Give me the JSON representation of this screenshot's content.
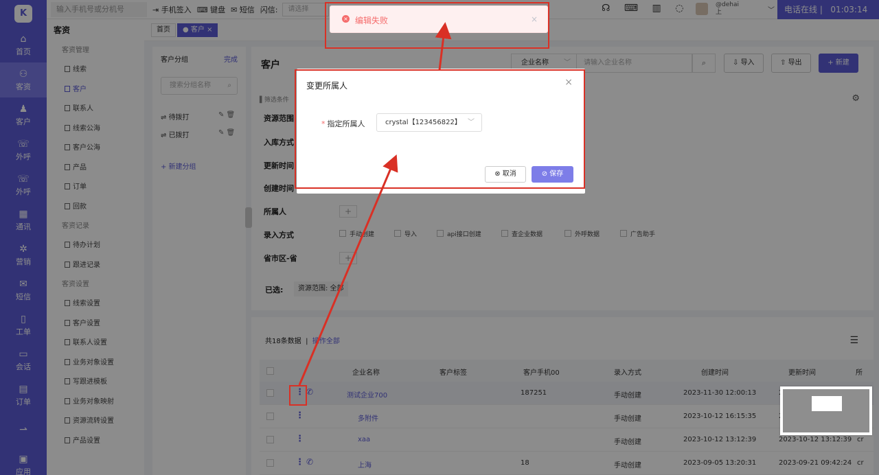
{
  "rail": {
    "logo": "K",
    "items": [
      {
        "icon": "⌂",
        "label": "首页"
      },
      {
        "icon": "⚇",
        "label": "客资"
      },
      {
        "icon": "♟",
        "label": "客户"
      },
      {
        "icon": "☏",
        "label": "外呼"
      },
      {
        "icon": "☏",
        "label": "外呼"
      },
      {
        "icon": "▦",
        "label": "通讯"
      },
      {
        "icon": "✲",
        "label": "营销"
      },
      {
        "icon": "✉",
        "label": "短信"
      },
      {
        "icon": "▯",
        "label": "工单"
      },
      {
        "icon": "▭",
        "label": "会话"
      },
      {
        "icon": "▤",
        "label": "订单"
      },
      {
        "icon": "⇀",
        "label": ""
      },
      {
        "icon": "▣",
        "label": "应用"
      }
    ]
  },
  "topbar": {
    "phone_placeholder": "输入手机号或分机号",
    "signin": "手机签入",
    "keyboard": "键盘",
    "sms": "短信",
    "flash_label": "闪信:",
    "flash_select": "请选择",
    "icons": "☊ ⌨ ▥ ◌",
    "user_line1": "@dehai",
    "user_line2": "上",
    "status": "电话在线 |",
    "timer": "01:03:14"
  },
  "submenu": {
    "title": "客资",
    "groups": [
      {
        "name": "客资管理",
        "items": [
          "线索",
          "客户",
          "联系人",
          "线索公海",
          "客户公海",
          "产品",
          "订单",
          "回款"
        ]
      },
      {
        "name": "客资记录",
        "items": [
          "待办计划",
          "跟进记录"
        ]
      },
      {
        "name": "客资设置",
        "items": [
          "线索设置",
          "客户设置",
          "联系人设置",
          "业务对象设置",
          "写跟进模板",
          "业务对象映射",
          "资源流转设置",
          "产品设置"
        ]
      }
    ]
  },
  "tabs": {
    "home": "首页",
    "current": "● 客户 ×"
  },
  "groups_panel": {
    "title": "客户分组",
    "done": "完成",
    "search_placeholder": "搜索分组名称",
    "items": [
      "待拨打",
      "已拨打"
    ],
    "add": "+ 新建分组"
  },
  "customer": {
    "title": "客户",
    "search_field": "企业名称",
    "search_placeholder": "请输入企业名称",
    "import": "导入",
    "export": "导出",
    "new": "+ 新建",
    "filter_hint": "筛选条件",
    "filters": [
      "资源范围",
      "入库方式",
      "更新时间",
      "创建时间",
      "所属人",
      "录入方式",
      "省市区-省"
    ],
    "entry_methods": [
      "手动创建",
      "导入",
      "api接口创建",
      "查企业数据",
      "外呼数据",
      "广告助手"
    ],
    "selected_label": "已选:",
    "selected_chip": "资源范围: 全部"
  },
  "list": {
    "count_text": "共18条数据",
    "select_all": "操作全部",
    "columns": [
      "企业名称",
      "客户标签",
      "客户手机00",
      "录入方式",
      "创建时间",
      "更新时间",
      "所"
    ],
    "rows": [
      {
        "name": "测试企业700",
        "phone": "187251",
        "method": "手动创建",
        "created": "2023-11-30 12:00:13",
        "updated": "202",
        "extra": ""
      },
      {
        "name": "多附件",
        "phone": "",
        "method": "手动创建",
        "created": "2023-10-12 16:15:35",
        "updated": "202",
        "extra": ""
      },
      {
        "name": "xaa",
        "phone": "",
        "method": "手动创建",
        "created": "2023-10-12 13:12:39",
        "updated": "2023-10-12 13:12:39",
        "extra": "cr"
      },
      {
        "name": "上海",
        "phone": "18",
        "method": "手动创建",
        "created": "2023-09-05 13:20:31",
        "updated": "2023-09-21 09:42:24",
        "extra": "cr"
      }
    ]
  },
  "toast": {
    "message": "编辑失败"
  },
  "dialog": {
    "title": "变更所属人",
    "field_label": "指定所属人",
    "field_value": "crystal【123456822】",
    "cancel": "取消",
    "save": "保存"
  }
}
